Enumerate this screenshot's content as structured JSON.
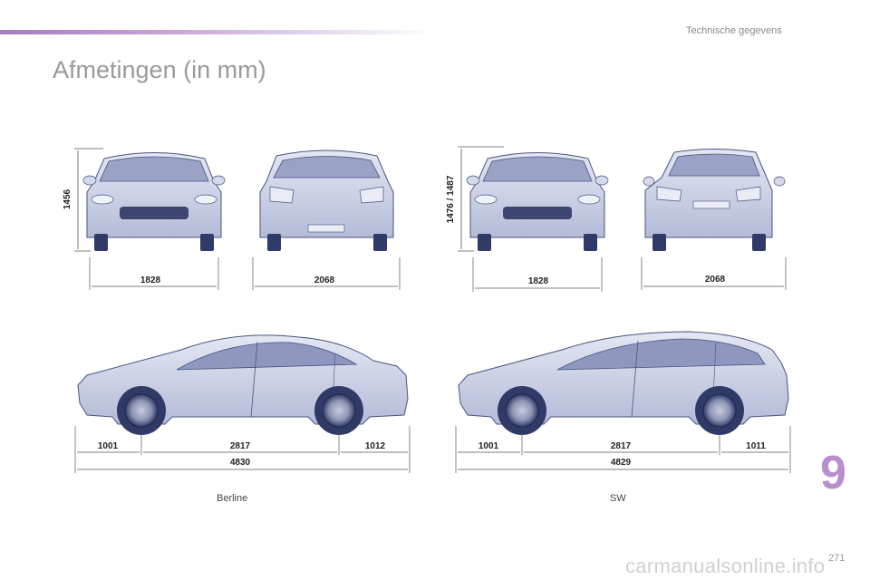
{
  "header": {
    "section": "Technische gegevens"
  },
  "title": "Afmetingen (in mm)",
  "berline": {
    "height": "1456",
    "front_width": "1828",
    "rear_width": "2068",
    "front_overhang": "1001",
    "wheelbase": "2817",
    "rear_overhang": "1012",
    "length": "4830",
    "caption": "Berline"
  },
  "sw": {
    "height": "1476 / 1487",
    "front_width": "1828",
    "rear_width": "2068",
    "front_overhang": "1001",
    "wheelbase": "2817",
    "rear_overhang": "1011",
    "length": "4829",
    "caption": "SW"
  },
  "chapter": "9",
  "page_number": "271",
  "watermark": "carmanualsonline.info",
  "colors": {
    "accent": "#b88fcc",
    "car_body": "#c7cde4",
    "tyre": "#2f3a66"
  }
}
